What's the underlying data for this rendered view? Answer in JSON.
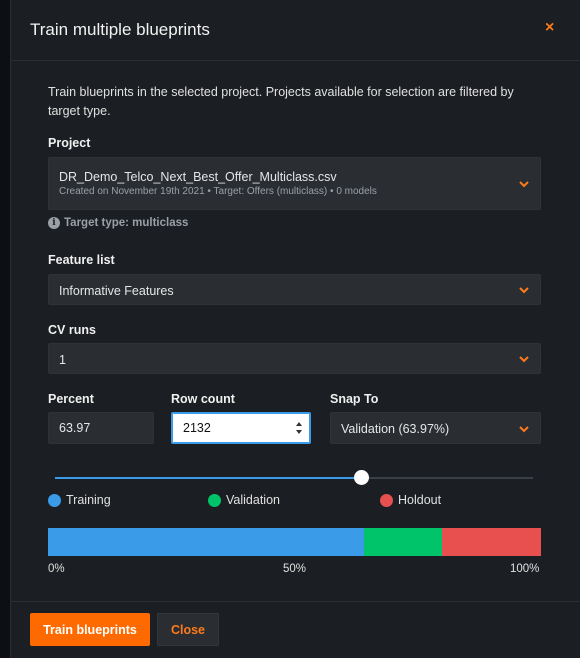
{
  "dialog": {
    "title": "Train multiple blueprints",
    "close_icon": "×"
  },
  "intro_text": "Train blueprints in the selected project. Projects available for selection are filtered by target type.",
  "project": {
    "label": "Project",
    "name": "DR_Demo_Telco_Next_Best_Offer_Multiclass.csv",
    "meta": "Created on November 19th 2021 • Target: Offers (multiclass) • 0 models",
    "target_type": "Target type: multiclass"
  },
  "feature_list": {
    "label": "Feature list",
    "value": "Informative Features"
  },
  "cv_runs": {
    "label": "CV runs",
    "value": "1"
  },
  "percent": {
    "label": "Percent",
    "value": "63.97"
  },
  "row_count": {
    "label": "Row count",
    "value": "2132"
  },
  "snap_to": {
    "label": "Snap To",
    "value": "Validation (63.97%)"
  },
  "slider": {
    "value_percent": 63.97
  },
  "legend": [
    {
      "label": "Training",
      "color": "#3a9be8"
    },
    {
      "label": "Validation",
      "color": "#00c46a"
    },
    {
      "label": "Holdout",
      "color": "#e8504f"
    }
  ],
  "partition_bar": {
    "training_percent": 64,
    "validation_percent": 16,
    "holdout_percent": 20,
    "scale": [
      "0%",
      "50%",
      "100%"
    ]
  },
  "footer": {
    "train_label": "Train blueprints",
    "close_label": "Close"
  },
  "colors": {
    "accent": "#ff6a00",
    "background": "#1b1e22",
    "field": "#2a2e33"
  }
}
